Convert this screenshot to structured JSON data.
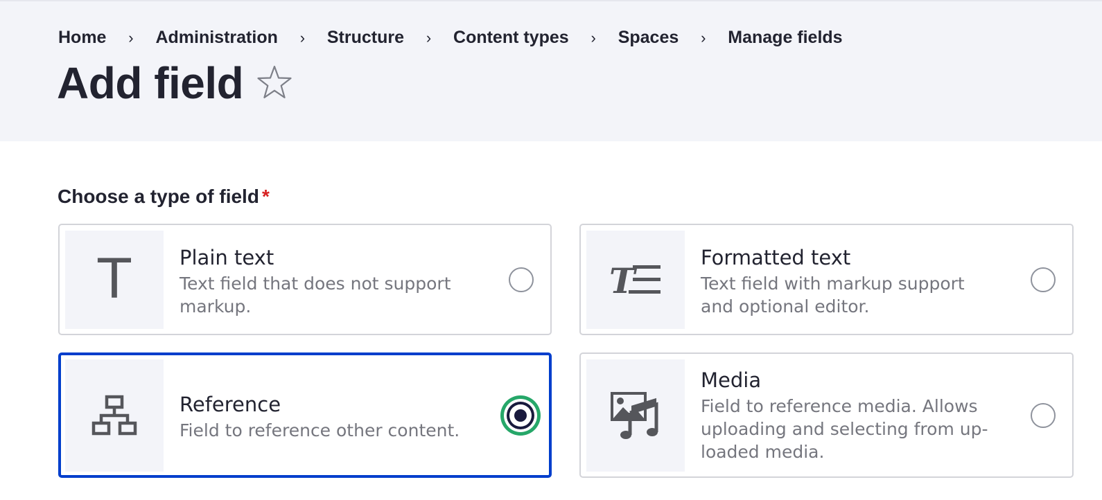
{
  "breadcrumb": {
    "items": [
      "Home",
      "Administration",
      "Structure",
      "Content types",
      "Spaces",
      "Manage fields"
    ],
    "separator": "›"
  },
  "page": {
    "title": "Add field",
    "favorite_icon": "star-outline-icon"
  },
  "form": {
    "label": "Choose a type of field",
    "required_marker": "*",
    "options": [
      {
        "title": "Plain text",
        "description": "Text field that does not support markup.",
        "icon": "plain-text-icon",
        "icon_glyph": "T",
        "selected": false
      },
      {
        "title": "Formatted text",
        "description": "Text field with markup support and optional editor.",
        "icon": "formatted-text-icon",
        "selected": false
      },
      {
        "title": "Reference",
        "description": "Field to reference other content.",
        "icon": "sitemap-icon",
        "selected": true
      },
      {
        "title": "Media",
        "description": "Field to reference media. Allows uploading and selecting from up-loaded media.",
        "icon": "media-icon",
        "selected": false
      }
    ]
  },
  "colors": {
    "header_bg": "#f3f4f9",
    "selected_border": "#003ecc",
    "focus_ring": "#26a769",
    "required": "#d72222",
    "text": "#222330",
    "muted_text": "#75767e"
  }
}
